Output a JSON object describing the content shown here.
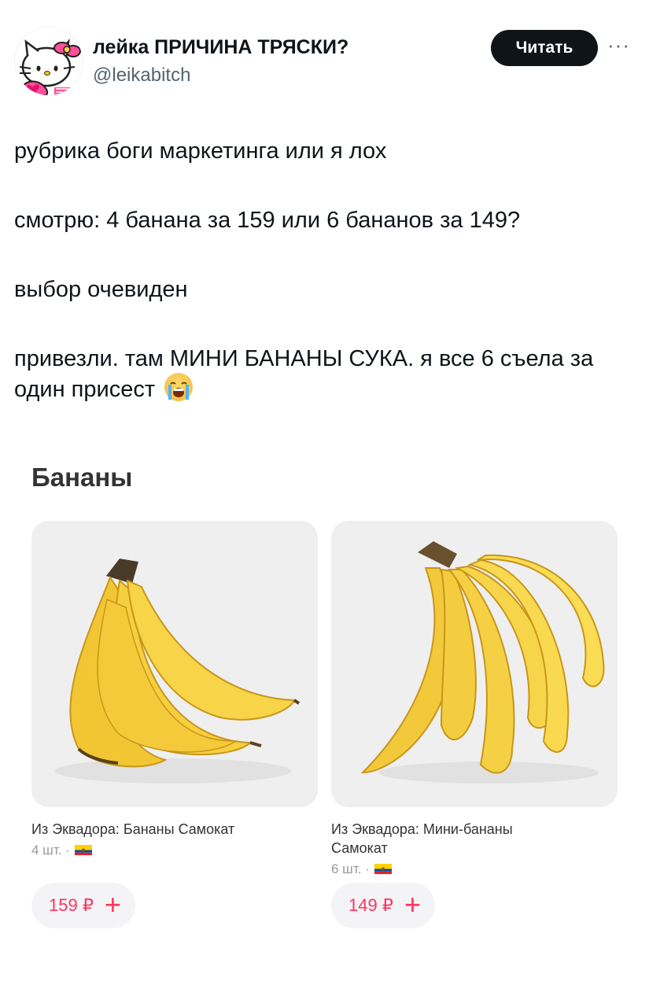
{
  "tweet": {
    "author_name": "лейка ПРИЧИНА ТРЯСКИ?",
    "handle": "@leikabitch",
    "follow_label": "Читать",
    "more_label": "···",
    "paragraphs": [
      "рубрика боги маркетинга или я лох",
      "смотрю: 4 банана за 159 или 6 бананов за 149?",
      "выбор очевиден",
      "привезли. там МИНИ БАНАНЫ СУКА. я все 6 съела за один присест"
    ],
    "emoji_icon": "loudly-crying-face-icon"
  },
  "shop": {
    "title": "Бананы",
    "products": [
      {
        "name": "Из Эквадора: Бананы Самокат",
        "count": "4 шт. ·",
        "price": "159 ₽",
        "add_icon": "plus-icon",
        "flag_icon": "ecuador-flag-icon",
        "image_icon": "banana-bunch-icon"
      },
      {
        "name": "Из Эквадора: Мини-бананы Самокат",
        "count": "6 шт. ·",
        "price": "149 ₽",
        "add_icon": "plus-icon",
        "flag_icon": "ecuador-flag-icon",
        "image_icon": "mini-banana-bunch-icon"
      }
    ],
    "accent_color": "#ff335f"
  }
}
